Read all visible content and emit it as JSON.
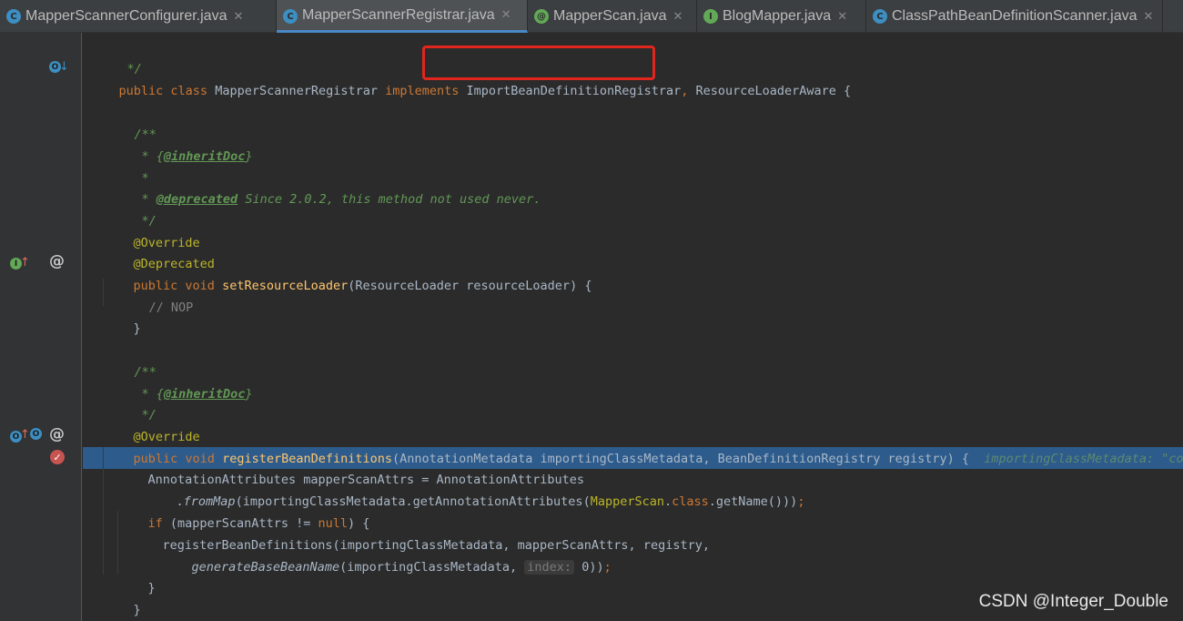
{
  "tabs": [
    {
      "label": "MapperScannerConfigurer.java",
      "icon": "class-icon",
      "glyph": "C"
    },
    {
      "label": "MapperScannerRegistrar.java",
      "icon": "class-icon",
      "glyph": "C"
    },
    {
      "label": "MapperScan.java",
      "icon": "annotation-icon",
      "glyph": "@"
    },
    {
      "label": "BlogMapper.java",
      "icon": "interface-icon",
      "glyph": "I"
    },
    {
      "label": "ClassPathBeanDefinitionScanner.java",
      "icon": "class-icon",
      "glyph": "C"
    }
  ],
  "active_tab": 1,
  "close_glyph": "✕",
  "code": {
    "l0": "*/",
    "l1_kw1": "public class ",
    "l1_name": "MapperScannerRegistrar ",
    "l1_kw2": "implements ",
    "l1_iface1": "ImportBeanDefinitionRegistrar",
    "l1_sep": ", ",
    "l1_iface2": "ResourceLoaderAware {",
    "doc_open": "/**",
    "doc_star": "* ",
    "inherit_open": "{",
    "inherit_tag": "@inheritDoc",
    "inherit_close": "}",
    "doc_star_only": "*",
    "deprecated_tag": "@deprecated",
    "deprecated_text": " Since 2.0.2, this method not used never.",
    "doc_close": "*/",
    "override": "@Override",
    "deprecated_ann": "@Deprecated",
    "set_kw": "public void ",
    "set_name": "setResourceLoader",
    "set_params": "(ResourceLoader resourceLoader) {",
    "nop": "// NOP",
    "close_brace": "}",
    "reg_kw": "public void ",
    "reg_name": "registerBeanDefinitions",
    "reg_params": "(AnnotationMetadata importingClassMetadata, BeanDefinitionRegistry registry) {",
    "reg_inline": "importingClassMetadata: \"com.yex.",
    "attrs_line": "AnnotationAttributes mapperScanAttrs = AnnotationAttributes",
    "frommap_dot": ".",
    "frommap_name": "fromMap",
    "frommap_args1": "(importingClassMetadata.getAnnotationAttributes(",
    "frommap_cls": "MapperScan",
    "frommap_dot2": ".",
    "frommap_class_kw": "class",
    "frommap_args2": ".getName()))",
    "frommap_semi": ";",
    "if_kw": "if ",
    "if_cond1": "(mapperScanAttrs != ",
    "if_null": "null",
    "if_cond2": ") {",
    "call_line": "registerBeanDefinitions(importingClassMetadata, mapperScanAttrs, registry,",
    "gen_name": "generateBaseBeanName",
    "gen_args": "(importingClassMetadata, ",
    "gen_hint": "index:",
    "gen_end": " 0))",
    "gen_semi": ";"
  },
  "gutter_icons": {
    "override_marker": "O",
    "impl_marker": "I",
    "down_arrow": "↓",
    "up_arrow": "↑",
    "at_marker": "@",
    "breakpoint": "✓"
  },
  "watermark": "CSDN @Integer_Double"
}
